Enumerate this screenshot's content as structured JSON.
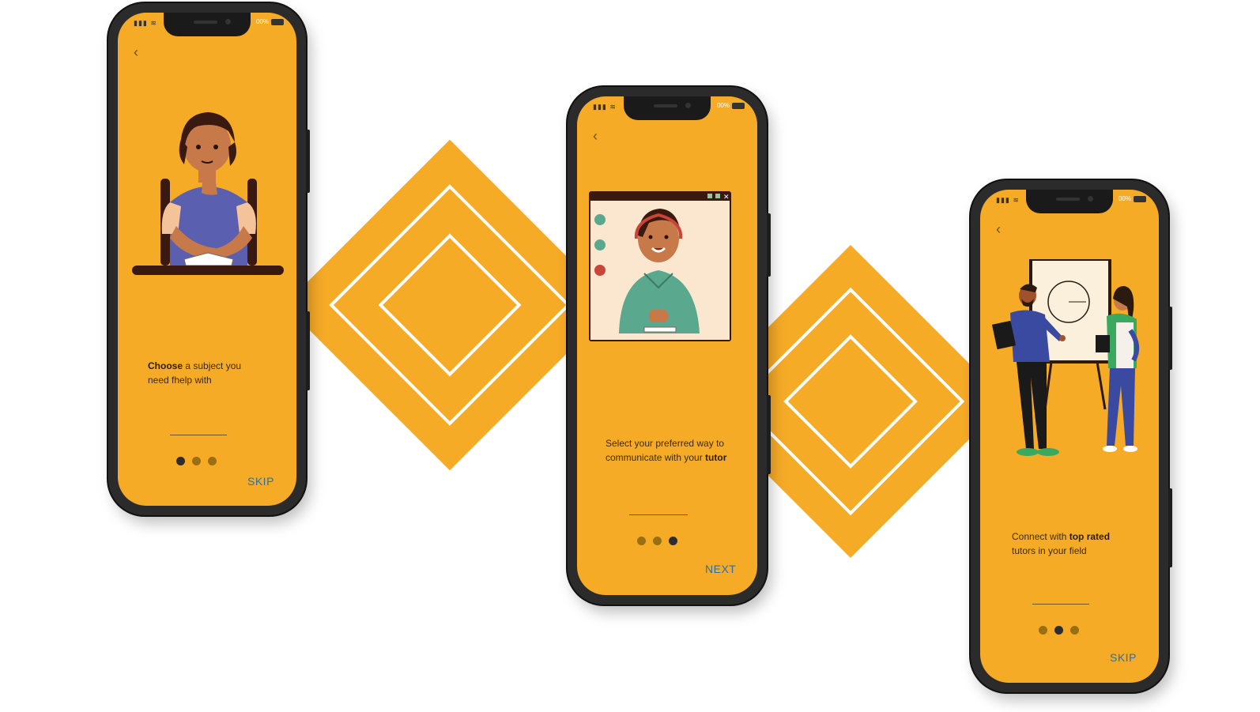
{
  "colors": {
    "accent": "#F6AB27",
    "action": "#2f6f9a",
    "dot_inactive": "#9a6f12",
    "dot_active": "#2d2d2d"
  },
  "phones": [
    {
      "status": {
        "battery": "00%"
      },
      "back_icon": "chevron-left-icon",
      "caption": {
        "bold": "Choose",
        "rest1": " a subject you",
        "line2": "need fhelp with"
      },
      "dots": {
        "count": 3,
        "active": 0
      },
      "action_label": "SKIP",
      "illustration": "girl-studying-at-desk"
    },
    {
      "status": {
        "battery": "00%"
      },
      "back_icon": "chevron-left-icon",
      "caption": {
        "line1": "Select your preferred way to",
        "line2_plain": "communicate with your ",
        "line2_bold": "tutor"
      },
      "dots": {
        "count": 3,
        "active": 2
      },
      "action_label": "NEXT",
      "illustration": "video-call-window"
    },
    {
      "status": {
        "battery": "00%"
      },
      "back_icon": "chevron-left-icon",
      "caption": {
        "line1_plain": "Connect with ",
        "line1_bold": "top rated",
        "line2": "tutors in your field"
      },
      "dots": {
        "count": 3,
        "active": 1
      },
      "action_label": "SKIP",
      "illustration": "tutor-and-student-whiteboard"
    }
  ]
}
